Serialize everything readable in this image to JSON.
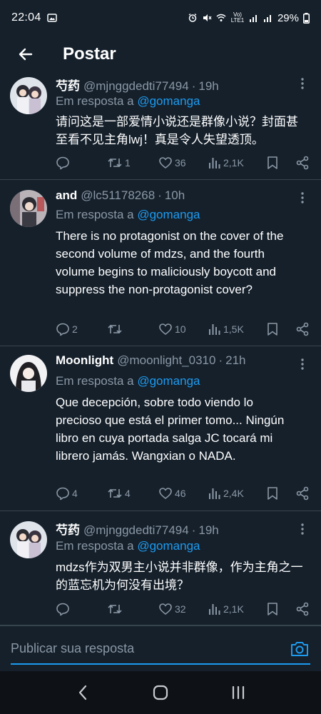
{
  "status_bar": {
    "time": "22:04",
    "battery": "29%",
    "network_badge": "Vo) LTE1"
  },
  "header": {
    "title": "Postar"
  },
  "tweets": [
    {
      "name": "芍药",
      "handle": "@mjnggdedti77494",
      "time": "19h",
      "reply_prefix": "Em resposta a",
      "reply_to": "@gomanga",
      "text": "请问这是一部爱情小说还是群像小说？封面甚至看不见主角lwj！真是令人失望透顶。",
      "replies": "",
      "retweets": "1",
      "likes": "36",
      "views": "2,1K"
    },
    {
      "name": "and",
      "handle": "@lc51178268",
      "time": "10h",
      "reply_prefix": "Em resposta a",
      "reply_to": "@gomanga",
      "text": "There is no protagonist on the cover of the second volume of mdzs, and the fourth volume begins to maliciously boycott and suppress the non-protagonist cover?",
      "replies": "2",
      "retweets": "",
      "likes": "10",
      "views": "1,5K"
    },
    {
      "name": "Moonlight",
      "handle": "@moonlight_0310",
      "time": "21h",
      "reply_prefix": "Em resposta a",
      "reply_to": "@gomanga",
      "text": "Que decepción, sobre todo viendo lo precioso que está el primer tomo... Ningún libro en cuya portada salga JC tocará mi librero jamás. Wangxian o NADA.",
      "replies": "4",
      "retweets": "4",
      "likes": "46",
      "views": "2,4K"
    },
    {
      "name": "芍药",
      "handle": "@mjnggdedti77494",
      "time": "19h",
      "reply_prefix": "Em resposta a",
      "reply_to": "@gomanga",
      "text": "mdzs作为双男主小说并非群像，作为主角之一的蓝忘机为何没有出境？",
      "replies": "",
      "retweets": "",
      "likes": "32",
      "views": "2,1K"
    }
  ],
  "reply_bar": {
    "placeholder": "Publicar sua resposta"
  },
  "colors": {
    "background": "#15202b",
    "accent": "#1d9bf0",
    "muted": "#8b98a5",
    "divider": "#38444d"
  }
}
